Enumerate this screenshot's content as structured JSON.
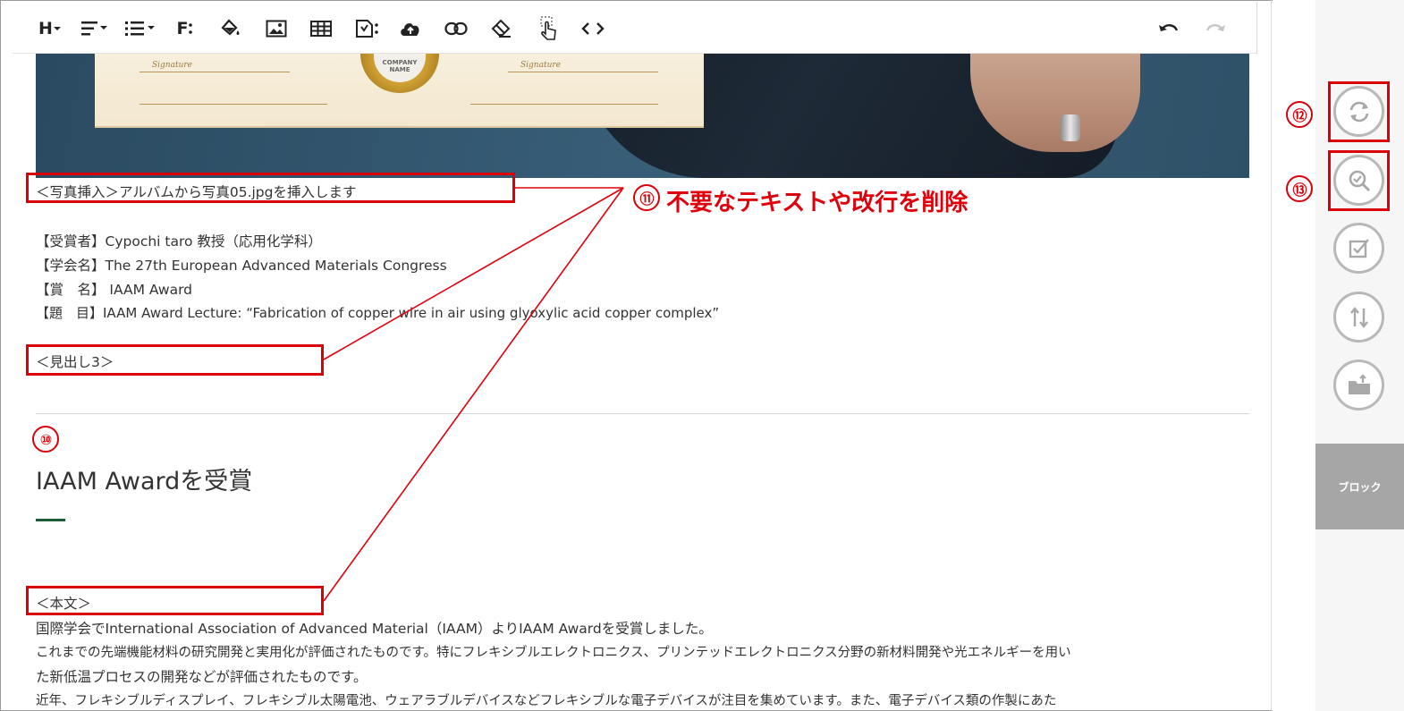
{
  "toolbar": {
    "heading": "H",
    "font": "F",
    "undo": "undo",
    "redo": "redo",
    "icons": [
      "heading-icon",
      "align-icon",
      "list-icon",
      "font-icon",
      "fill-color-icon",
      "image-icon",
      "table-icon",
      "file-icon",
      "upload-icon",
      "link-icon",
      "eraser-icon",
      "pointer-icon",
      "code-icon",
      "undo-icon",
      "redo-icon"
    ]
  },
  "image": {
    "signature_left": "Signature",
    "signature_right": "Signature",
    "seal_text": "COMPANY NAME"
  },
  "content": {
    "photo_note": "＜写真挿入＞アルバムから写真05.jpgを挿入します",
    "award_lines": [
      "【受賞者】Cypochi taro 教授（応用化学科）",
      "【学会名】The 27th European Advanced Materials Congress",
      "【賞　名】 IAAM Award",
      "【題　目】IAAM Award Lecture: “Fabrication of copper wire in air using glyoxylic acid copper complex”"
    ],
    "heading_note": "＜見出し3＞",
    "heading3": "IAAM Awardを受賞",
    "body_note": "＜本文＞",
    "body_lines": [
      "国際学会でInternational Association of Advanced Material（IAAM）よりIAAM Awardを受賞しました。",
      "これまでの先端機能材料の研究開発と実用化が評価されたものです。特にフレキシブルエレクトロニクス、プリンテッドエレクトロニクス分野の新材料開発や光エネルギーを用い",
      "た新低温プロセスの開発などが評価されたものです。",
      "近年、フレキシブルディスプレイ、フレキシブル太陽電池、ウェアラブルデバイスなどフレキシブルな電子デバイスが注目を集めています。また、電子デバイス類の作製にあた"
    ]
  },
  "annotations": {
    "n10": "⑩",
    "n11": "⑪",
    "n11_label": "不要なテキストや改行を削除",
    "n12": "⑫",
    "n13": "⑬",
    "color": "#d9000a"
  },
  "sidepanel": {
    "buttons": [
      "refresh-icon",
      "zoom-check-icon",
      "checkbox-icon",
      "sort-icon",
      "folder-upload-icon"
    ],
    "block_tab": "ブロック"
  }
}
